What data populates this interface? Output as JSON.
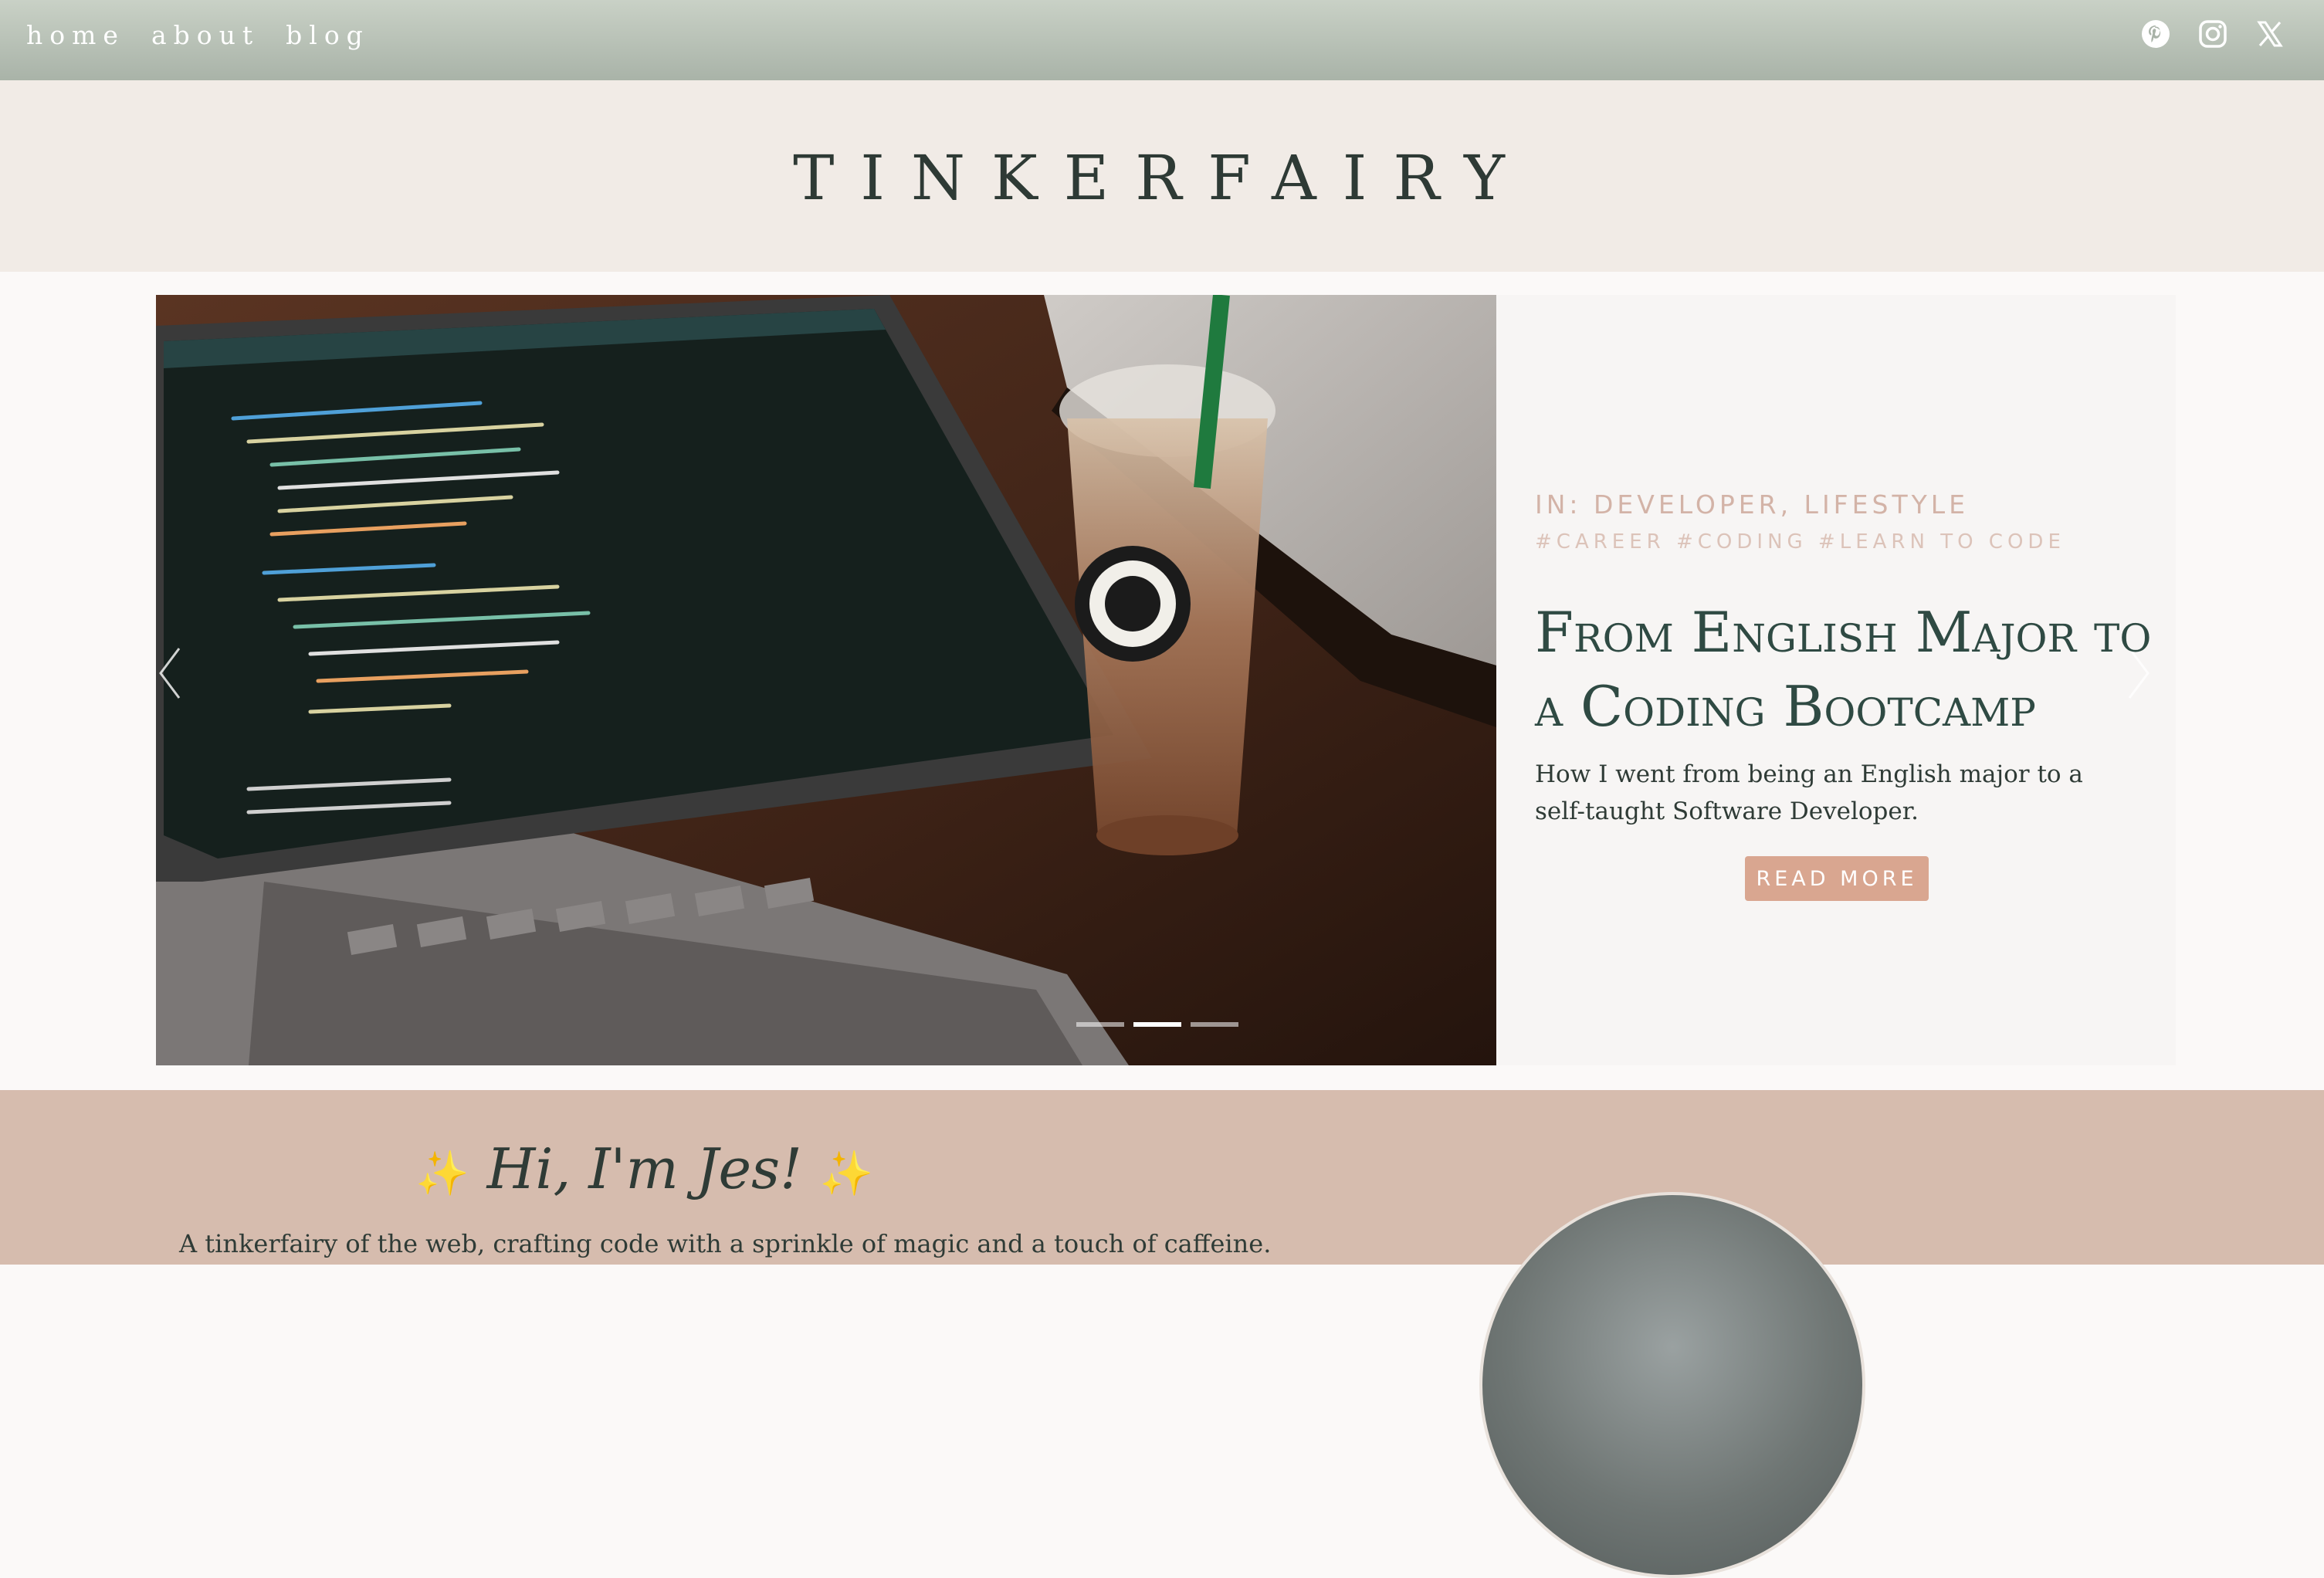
{
  "nav": {
    "links": [
      "home",
      "about",
      "blog"
    ],
    "social": [
      "pinterest-icon",
      "instagram-icon",
      "x-icon"
    ]
  },
  "site": {
    "logo": "TINKERFAIRY"
  },
  "hero": {
    "categories": "IN: DEVELOPER, LIFESTYLE",
    "tags": "#CAREER #CODING #LEARN TO CODE",
    "title": "From English Major to a Coding Bootcamp",
    "excerpt": "How I went from being an English major to a self-taught Software Developer.",
    "button": "READ MORE",
    "slides": {
      "count": 3,
      "active": 2
    }
  },
  "about": {
    "greeting": "Hi, I'm Jes!",
    "sparkle": "✨",
    "tagline": "A tinkerfairy of the web, crafting code with a sprinkle of magic and a touch of caffeine."
  },
  "colors": {
    "nav_bg": "#b4bdb2",
    "logo_band": "#f1ebe6",
    "accent": "#d9a690",
    "title_green": "#2f4a43",
    "about_bg": "#d6bcae"
  }
}
